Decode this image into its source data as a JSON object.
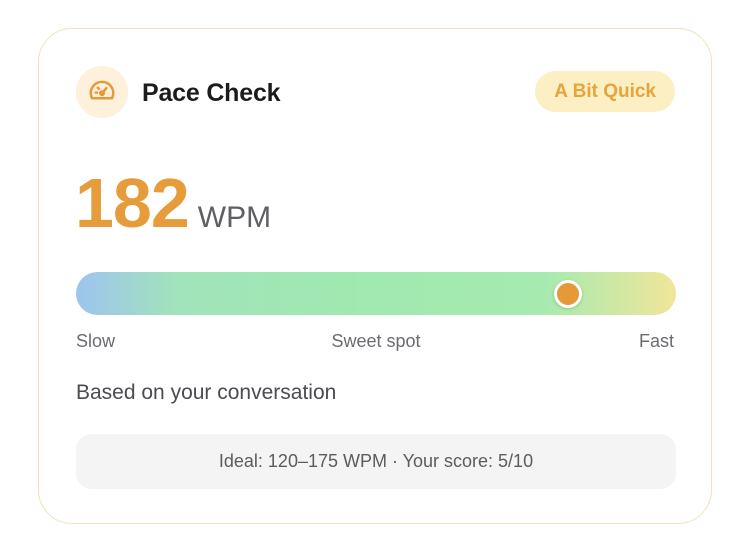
{
  "card": {
    "title": "Pace Check",
    "icon": "speedometer-icon",
    "badge": "A Bit Quick",
    "colors": {
      "accent": "#e79c3b",
      "badge_bg": "#fdefc4",
      "border": "#f1e2bd"
    }
  },
  "pace": {
    "value": "182",
    "unit": "WPM",
    "marker_position_pct": 82
  },
  "scale": {
    "slow": "Slow",
    "sweet": "Sweet spot",
    "fast": "Fast"
  },
  "source_text": "Based on your conversation",
  "footer_text": "Ideal: 120–175 WPM · Your score: 5/10"
}
